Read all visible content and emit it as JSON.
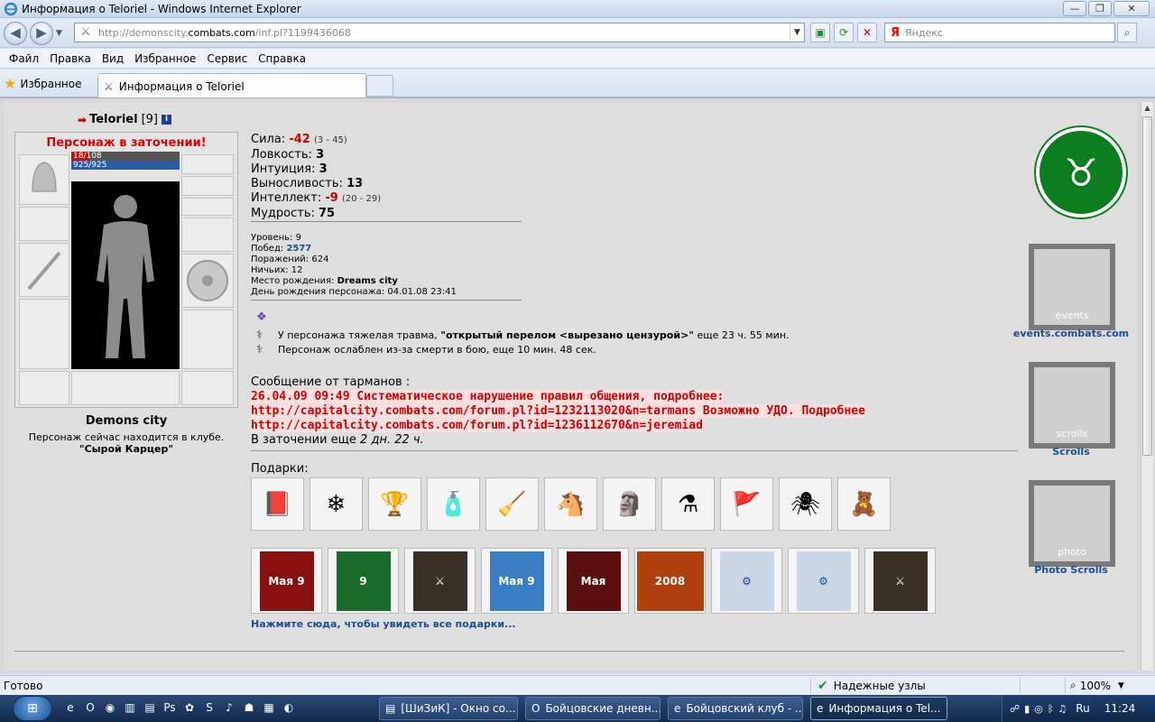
{
  "window": {
    "title": "Информация о Teloriel - Windows Internet Explorer",
    "min": "—",
    "max": "❐",
    "close": "✕"
  },
  "address": {
    "url_prefix": "http://demonscity.",
    "url_domain": "combats.com",
    "url_path": "/inf.pl?1199436068",
    "search_brand": "Я",
    "search_placeholder": "Яндекс"
  },
  "menu": [
    "Файл",
    "Правка",
    "Вид",
    "Избранное",
    "Сервис",
    "Справка"
  ],
  "favorites_label": "Избранное",
  "tab_title": "Информация о Teloriel",
  "character": {
    "name": "Teloriel",
    "level": "[9]",
    "status": "Персонаж в заточении!",
    "hp": "18/108",
    "hp_fraction": 0.17,
    "mana": "925/925",
    "city": "Demons city",
    "location_text": "Персонаж сейчас находится в клубе.",
    "location_room": "\"Сырой Карцер\""
  },
  "stats": [
    {
      "label": "Сила:",
      "value": "-42",
      "range": "(3 - 45)",
      "negative": true
    },
    {
      "label": "Ловкость:",
      "value": "3",
      "range": "",
      "negative": false
    },
    {
      "label": "Интуиция:",
      "value": "3",
      "range": "",
      "negative": false
    },
    {
      "label": "Выносливость:",
      "value": "13",
      "range": "",
      "negative": false
    },
    {
      "label": "Интеллект:",
      "value": "-9",
      "range": "(20 - 29)",
      "negative": true
    },
    {
      "label": "Мудрость:",
      "value": "75",
      "range": "",
      "negative": false
    }
  ],
  "info": {
    "level": "Уровень: 9",
    "wins_label": "Побед:",
    "wins": "2577",
    "losses": "Поражений: 624",
    "draws": "Ничьих: 12",
    "birthplace_label": "Место рождения:",
    "birthplace": "Dreams city",
    "birthday": "День рождения персонажа: 04.01.08 23:41"
  },
  "effects": {
    "trauma_prefix": "У персонажа тяжелая травма,",
    "trauma_name": "\"открытый перелом <вырезано цензурой>\"",
    "trauma_suffix": "еще 23 ч. 55 мин.",
    "weak": "Персонаж ослаблен из-за смерти в бою, еще 10 мин. 48 сек."
  },
  "message": {
    "header": "Сообщение от тарманов :",
    "line1": "26.04.09 09:49 Систематическое нарушение правил общения, подробнее:",
    "line2": "http://capitalcity.combats.com/forum.pl?id=1232113020&n=tarmans Возможно УДО. Подробнее",
    "line3": "http://capitalcity.combats.com/forum.pl?id=1236112670&n=jeremiad",
    "prison_prefix": "В заточении еще",
    "prison_time": "2 дн. 22 ч."
  },
  "gifts": {
    "label": "Подарки:",
    "row1": [
      "📕",
      "❄",
      "🏆",
      "🧴",
      "🧹",
      "🐴",
      "🗿",
      "⚗",
      "🚩",
      "🕷",
      "🧸"
    ],
    "cards": [
      "Мая 9",
      "9",
      "⚔",
      "Мая 9",
      "Мая",
      "2008",
      "⚙",
      "⚙",
      "⚔"
    ],
    "see_all": "Нажмите сюда, чтобы увидеть все подарки..."
  },
  "sidebar": {
    "logo": "♉",
    "events_inner": "events",
    "events_link": "events.combats.com",
    "scrolls_inner": "scrolls",
    "scrolls_link": "Scrolls",
    "photo_inner": "photo",
    "photo_link": "Photo Scrolls"
  },
  "status": {
    "ready": "Готово",
    "zone": "Надежные узлы",
    "zoom": "100%"
  },
  "taskbar": {
    "tasks": [
      "[ШиЗиК] - Окно со...",
      "Бойцовские дневн...",
      "Бойцовский клуб - ...",
      "Информация о Tel..."
    ],
    "lang": "Ru",
    "clock": "11:24"
  },
  "colors": {
    "accent_red": "#d00000",
    "link_blue": "#1d4c96",
    "logo_green": "#0b7d1d"
  }
}
